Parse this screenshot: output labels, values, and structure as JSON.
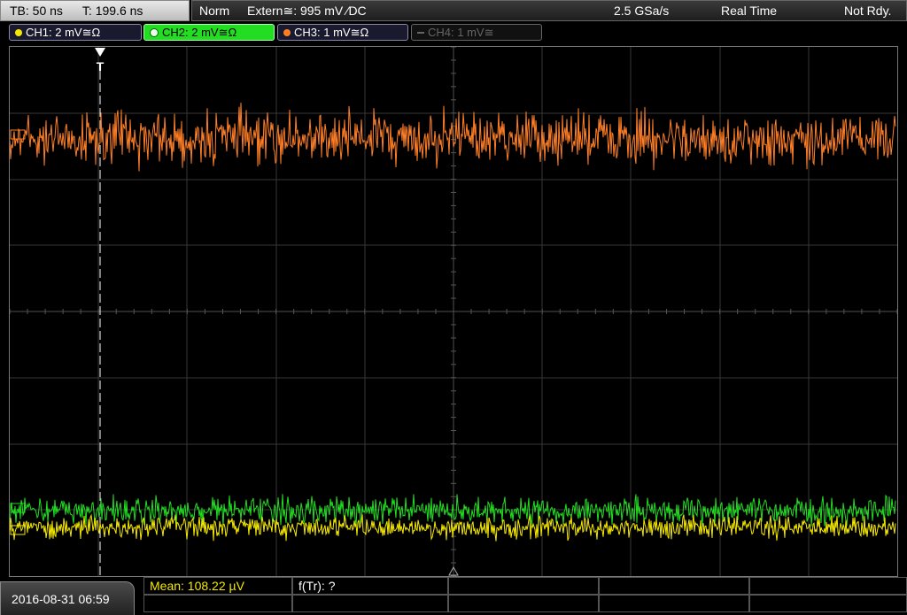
{
  "header": {
    "timebase": "TB: 50 ns",
    "trigger_time": "T: 199.6 ns",
    "mode": "Norm",
    "trigger_source": "Extern≅: 995 mV ⁄DC",
    "sample_rate": "2.5 GSa/s",
    "acquisition": "Real Time",
    "status": "Not Rdy."
  },
  "channels": [
    {
      "label": "CH1: 2 mV≅Ω",
      "color": "#f4e800",
      "active": false
    },
    {
      "label": "CH2: 2 mV≅Ω",
      "color": "#22dd22",
      "active": true
    },
    {
      "label": "CH3: 1 mV≅Ω",
      "color": "#ff7f27",
      "active": false
    },
    {
      "label": "CH4: 1 mV≅",
      "color": "#777777",
      "active": false
    }
  ],
  "traces": {
    "ch3_color": "#ff7f27",
    "ch2_color": "#22dd22",
    "ch1_color": "#f4e800"
  },
  "footer": {
    "datetime": "2016-08-31 06:59",
    "mean": "Mean: 108.22 µV",
    "freq": "f(Tr): ?"
  }
}
